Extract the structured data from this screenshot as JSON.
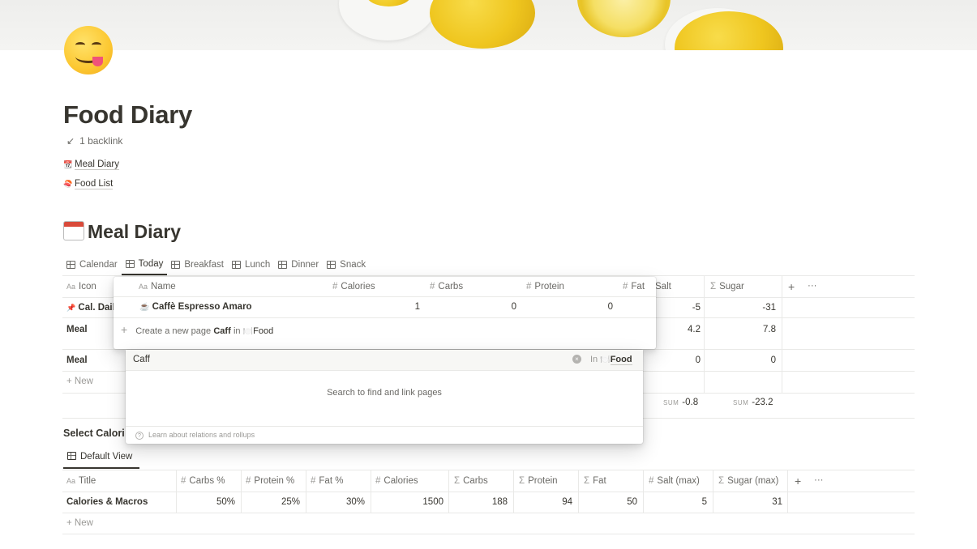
{
  "page": {
    "title": "Food Diary",
    "backlink_arrow": "↙",
    "backlink": "1 backlink",
    "links": [
      {
        "icon": "calendar-icon",
        "label": "Meal Diary"
      },
      {
        "icon": "sushi-icon",
        "label": "Food List"
      }
    ],
    "icon": "smiling-face-tongue-icon"
  },
  "meal_diary": {
    "heading": "Meal Diary",
    "tabs": [
      "Calendar",
      "Today",
      "Breakfast",
      "Lunch",
      "Dinner",
      "Snack"
    ],
    "active_tab": "Today",
    "columns": [
      "Icon",
      "Salt",
      "Sugar"
    ],
    "rows": [
      {
        "name": "Cal. Dail",
        "salt": "-5",
        "sugar": "-31"
      },
      {
        "name": "Meal",
        "salt": "4.2",
        "sugar": "7.8"
      },
      {
        "name": "Meal",
        "salt": "0",
        "sugar": "0"
      }
    ],
    "new_label": "New",
    "sum_label": "SUM",
    "sum_salt": "-0.8",
    "sum_sugar": "-23.2",
    "add_label": "+",
    "more_label": "···"
  },
  "relation_popup": {
    "columns": [
      "Name",
      "Calories",
      "Carbs",
      "Protein",
      "Fat"
    ],
    "result": {
      "icon": "coffee-icon",
      "name": "Caffè Espresso Amaro",
      "calories": "1",
      "carbs": "0",
      "protein": "0"
    },
    "create_prefix": "Create a new page",
    "create_query": "Caff",
    "create_in": "in",
    "create_db": "Food"
  },
  "search_popup": {
    "query": "Caff",
    "in_label": "In",
    "db": "Food",
    "empty_message": "Search to find and link pages",
    "help": "Learn about relations and rollups"
  },
  "select_calories": {
    "heading": "Select Calori",
    "view_tab": "Default View",
    "columns": [
      "Title",
      "Carbs %",
      "Protein %",
      "Fat %",
      "Calories",
      "Carbs",
      "Protein",
      "Fat",
      "Salt (max)",
      "Sugar (max)"
    ],
    "row": [
      "Calories & Macros",
      "50%",
      "25%",
      "30%",
      "1500",
      "188",
      "94",
      "50",
      "5",
      "31"
    ],
    "new_label": "New"
  }
}
